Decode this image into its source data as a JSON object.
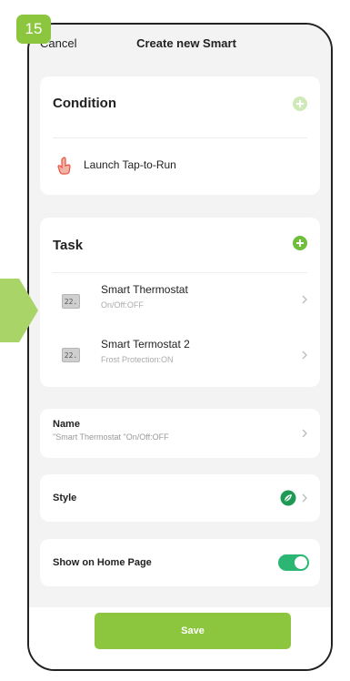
{
  "step_badge": "15",
  "nav": {
    "cancel_label": "Cancel",
    "title": "Create new Smart"
  },
  "condition": {
    "title": "Condition",
    "item_label": "Launch Tap-to-Run"
  },
  "task": {
    "title": "Task",
    "items": [
      {
        "icon_text": "22.",
        "name": "Smart Thermostat",
        "status": "On/Off:OFF"
      },
      {
        "icon_text": "22.",
        "name": "Smart Termostat 2",
        "status": "Frost Protection:ON"
      }
    ]
  },
  "name_row": {
    "label": "Name",
    "value": "\"Smart Thermostat \"On/Off:OFF"
  },
  "style_row": {
    "label": "Style"
  },
  "home_row": {
    "label": "Show on Home Page",
    "toggle_on": true
  },
  "save_label": "Save",
  "colors": {
    "accent_green": "#6fbf3a",
    "toggle_green": "#2bb673",
    "plus_light": "#cfe9b8",
    "save_green": "#8cc63f",
    "hand_red": "#e8533f",
    "badge_green": "#8cc63f"
  },
  "icons": {
    "condition_add": "plus-circle-icon",
    "condition_item": "hand-tap-icon",
    "task_add": "plus-circle-icon",
    "task_item": "thermostat-icon",
    "chevron": "chevron-right-icon",
    "style": "leaf-icon"
  }
}
